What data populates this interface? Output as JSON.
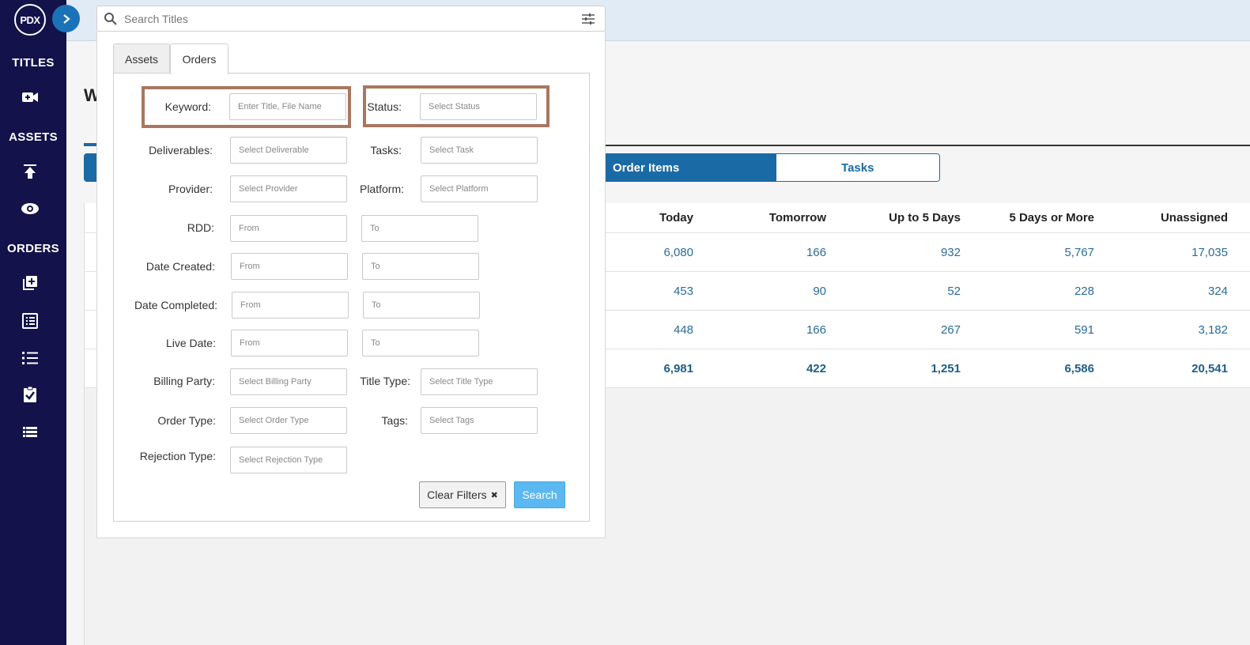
{
  "app": {
    "logo_text": "PDX"
  },
  "sidebar": {
    "sections": [
      {
        "label": "TITLES",
        "icons": [
          "add-video-icon"
        ]
      },
      {
        "label": "ASSETS",
        "icons": [
          "upload-icon",
          "eye-icon"
        ]
      },
      {
        "label": "ORDERS",
        "icons": [
          "add-order-icon",
          "order-list-icon",
          "checklist-icon",
          "task-clipboard-icon",
          "table-list-icon"
        ]
      }
    ]
  },
  "page": {
    "heading": "W"
  },
  "view_toggle": {
    "options": [
      "Order Items",
      "Tasks"
    ],
    "active": "Order Items"
  },
  "table": {
    "headers": [
      "Today",
      "Tomorrow",
      "Up to 5 Days",
      "5 Days or More",
      "Unassigned"
    ],
    "rows": [
      [
        "6,080",
        "166",
        "932",
        "5,767",
        "17,035"
      ],
      [
        "453",
        "90",
        "52",
        "228",
        "324"
      ],
      [
        "448",
        "166",
        "267",
        "591",
        "3,182"
      ]
    ],
    "totals": [
      "6,981",
      "422",
      "1,251",
      "6,586",
      "20,541"
    ]
  },
  "search": {
    "placeholder": "Search Titles",
    "tabs": [
      "Assets",
      "Orders"
    ],
    "active_tab": "Orders",
    "filters": {
      "keyword": {
        "label": "Keyword:",
        "placeholder": "Enter Title, File Name"
      },
      "status": {
        "label": "Status:",
        "placeholder": "Select Status"
      },
      "deliverables": {
        "label": "Deliverables:",
        "placeholder": "Select Deliverable"
      },
      "tasks": {
        "label": "Tasks:",
        "placeholder": "Select Task"
      },
      "provider": {
        "label": "Provider:",
        "placeholder": "Select Provider"
      },
      "platform": {
        "label": "Platform:",
        "placeholder": "Select Platform"
      },
      "rdd": {
        "label": "RDD:",
        "from": "From",
        "to": "To"
      },
      "date_created": {
        "label": "Date Created:",
        "from": "From",
        "to": "To"
      },
      "date_completed": {
        "label": "Date Completed:",
        "from": "From",
        "to": "To"
      },
      "live_date": {
        "label": "Live Date:",
        "from": "From",
        "to": "To"
      },
      "billing_party": {
        "label": "Billing Party:",
        "placeholder": "Select Billing Party"
      },
      "title_type": {
        "label": "Title Type:",
        "placeholder": "Select Title Type"
      },
      "order_type": {
        "label": "Order Type:",
        "placeholder": "Select Order Type"
      },
      "tags": {
        "label": "Tags:",
        "placeholder": "Select Tags"
      },
      "rejection_type": {
        "label": "Rejection Type:",
        "placeholder": "Select Rejection Type"
      }
    },
    "clear_label": "Clear Filters",
    "clear_icon": "✖",
    "search_label": "Search"
  },
  "colors": {
    "sidebar_bg": "#13124a",
    "accent": "#1a6aa6",
    "highlight_border": "#a8775f",
    "search_button": "#5bb8f0"
  }
}
